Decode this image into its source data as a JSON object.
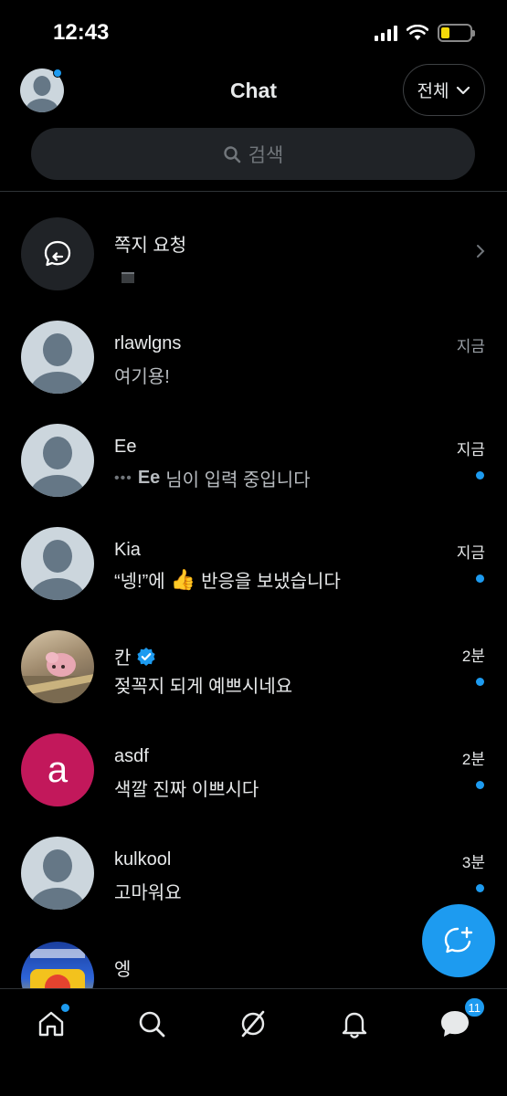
{
  "status_bar": {
    "time": "12:43"
  },
  "header": {
    "title": "Chat",
    "filter_label": "전체"
  },
  "search": {
    "placeholder": "검색"
  },
  "message_requests": {
    "title": "쪽지 요청"
  },
  "conversations": [
    {
      "name": "rlawlgns",
      "preview": "여기용!",
      "time": "지금",
      "unread": false
    },
    {
      "name": "Ee",
      "typing_name": "Ee",
      "preview": "님이 입력 중입니다",
      "time": "지금",
      "unread": true
    },
    {
      "name": "Kia",
      "preview_before": "“넹!”에",
      "preview_after": "반응을 보냈습니다",
      "reaction_emoji": "👍",
      "time": "지금",
      "unread": true
    },
    {
      "name": "칸",
      "verified": true,
      "preview": "젖꼭지 되게 예쁘시네요",
      "time": "2분",
      "unread": true
    },
    {
      "name": "asdf",
      "avatar_letter": "a",
      "avatar_color": "#c2185b",
      "preview": "색깔 진짜 이쁘시다",
      "time": "2분",
      "unread": true
    },
    {
      "name": "kulkool",
      "preview": "고마워요",
      "time": "3분",
      "unread": true
    },
    {
      "name": "엥",
      "time": "",
      "unread": false
    }
  ],
  "tabbar": {
    "items": [
      "home-icon",
      "search-icon",
      "grok-icon",
      "notifications-icon",
      "messages-icon"
    ],
    "messages_badge": "11"
  },
  "colors": {
    "accent": "#1d9bf0",
    "background": "#000000",
    "surface": "#202327"
  }
}
